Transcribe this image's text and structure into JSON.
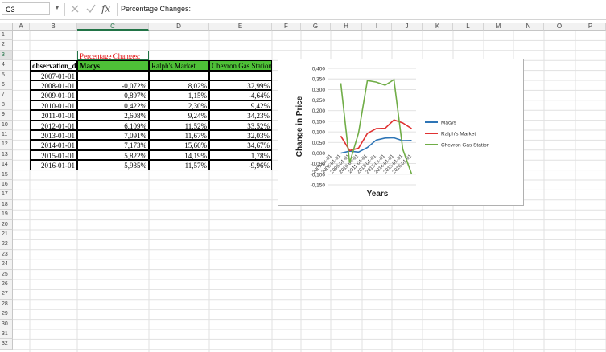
{
  "formula_bar": {
    "name_box": "C3",
    "fx_label": "fx",
    "formula": "Percentage Changes:"
  },
  "columns": [
    "A",
    "B",
    "C",
    "D",
    "E",
    "F",
    "G",
    "H",
    "I",
    "J",
    "K",
    "L",
    "M",
    "N",
    "O",
    "P"
  ],
  "rows": [
    "1",
    "2",
    "3",
    "4",
    "5",
    "6",
    "7",
    "8",
    "9",
    "10",
    "11",
    "12",
    "13",
    "14",
    "15",
    "16",
    "17",
    "18",
    "19",
    "20",
    "21",
    "22",
    "23",
    "24",
    "25",
    "26",
    "27",
    "28",
    "29",
    "30",
    "31",
    "32"
  ],
  "sheet": {
    "title_cell": "Percentage Changes:",
    "headers": {
      "date": "observation_date",
      "macys": "Macys",
      "ralph": "Ralph's Market",
      "chevron": "Chevron Gas Station"
    },
    "records": [
      {
        "date": "2007-01-01",
        "macys": "",
        "ralph": "",
        "chevron": ""
      },
      {
        "date": "2008-01-01",
        "macys": "-0,072%",
        "ralph": "8,02%",
        "chevron": "32,99%"
      },
      {
        "date": "2009-01-01",
        "macys": "0,897%",
        "ralph": "1,15%",
        "chevron": "-4,64%"
      },
      {
        "date": "2010-01-01",
        "macys": "0,422%",
        "ralph": "2,30%",
        "chevron": "9,42%"
      },
      {
        "date": "2011-01-01",
        "macys": "2,608%",
        "ralph": "9,24%",
        "chevron": "34,23%"
      },
      {
        "date": "2012-01-01",
        "macys": "6,109%",
        "ralph": "11,52%",
        "chevron": "33,52%"
      },
      {
        "date": "2013-01-01",
        "macys": "7,091%",
        "ralph": "11,67%",
        "chevron": "32,03%"
      },
      {
        "date": "2014-01-01",
        "macys": "7,173%",
        "ralph": "15,66%",
        "chevron": "34,67%"
      },
      {
        "date": "2015-01-01",
        "macys": "5,822%",
        "ralph": "14,19%",
        "chevron": "1,78%"
      },
      {
        "date": "2016-01-01",
        "macys": "5,935%",
        "ralph": "11,57%",
        "chevron": "-9,96%"
      }
    ]
  },
  "chart_data": {
    "type": "line",
    "xlabel": "Years",
    "ylabel": "Change in Price",
    "ylim": [
      -0.15,
      0.4
    ],
    "yticks": [
      "0,400",
      "0,350",
      "0,300",
      "0,250",
      "0,200",
      "0,150",
      "0,100",
      "0,050",
      "0,000",
      "-0,050",
      "-0,100",
      "-0,150"
    ],
    "categories": [
      "2007-01-01",
      "2008-01-01",
      "2009-01-01",
      "2010-01-01",
      "2011-01-01",
      "2012-01-01",
      "2013-01-01",
      "2014-01-01",
      "2015-01-01",
      "2016-01-01"
    ],
    "legend_position": "right",
    "grid": true,
    "series": [
      {
        "name": "Macys",
        "color": "#2e75b6",
        "values": [
          null,
          -0.00072,
          0.00897,
          0.00422,
          0.02608,
          0.06109,
          0.07091,
          0.07173,
          0.05822,
          0.05935
        ]
      },
      {
        "name": "Ralph's Market",
        "color": "#e03232",
        "values": [
          null,
          0.0802,
          0.0115,
          0.023,
          0.0924,
          0.1152,
          0.1167,
          0.1566,
          0.1419,
          0.1157
        ]
      },
      {
        "name": "Chevron Gas Station",
        "color": "#70ad47",
        "values": [
          null,
          0.3299,
          -0.0464,
          0.0942,
          0.3423,
          0.3352,
          0.3203,
          0.3467,
          0.0178,
          -0.0996
        ]
      }
    ]
  }
}
